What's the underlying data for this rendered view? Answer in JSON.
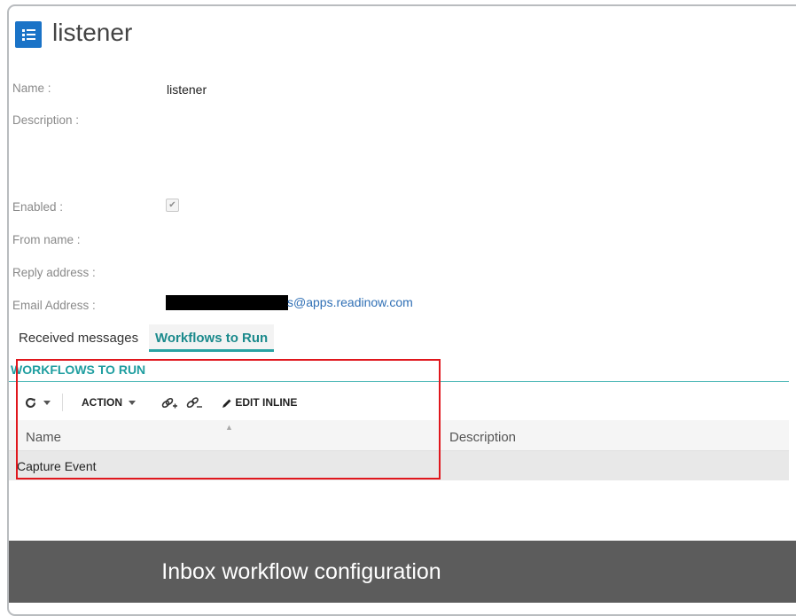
{
  "header": {
    "title": "listener",
    "icon": "list-icon"
  },
  "fields": {
    "name_label": "Name :",
    "name_value": "listener",
    "description_label": "Description :",
    "enabled_label": "Enabled :",
    "enabled_checked": true,
    "from_name_label": "From name :",
    "reply_address_label": "Reply address :",
    "email_label": "Email Address :",
    "email_visible_part": "s@apps.readinow.com"
  },
  "tabs": [
    {
      "label": "Received messages",
      "active": false
    },
    {
      "label": "Workflows to Run",
      "active": true
    }
  ],
  "section": {
    "title": "WORKFLOWS TO RUN"
  },
  "toolbar": {
    "refresh_icon": "refresh-icon",
    "action_label": "ACTION",
    "link_icon": "link-add-icon",
    "unlink_icon": "link-remove-icon",
    "edit_inline_label": "EDIT INLINE"
  },
  "grid": {
    "columns": [
      "Name",
      "Description"
    ],
    "rows": [
      {
        "name": "Capture Event",
        "description": ""
      }
    ]
  },
  "caption": "Inbox workflow configuration",
  "colors": {
    "accent_teal": "#1f9ea0",
    "icon_blue": "#1a73c7",
    "highlight_red": "#e0171d",
    "link_blue": "#2f6fb5",
    "caption_bg": "#5c5c5c"
  }
}
